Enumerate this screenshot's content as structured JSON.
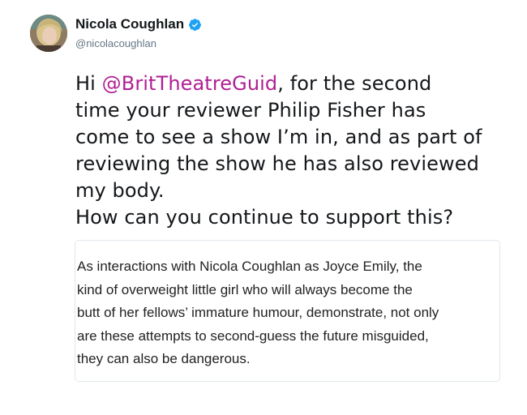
{
  "tweet": {
    "author": {
      "display_name": "Nicola Coughlan",
      "handle": "@nicolacoughlan",
      "verified": true,
      "verified_icon": "verified-badge-icon",
      "verified_color": "#1da1f2"
    },
    "text": {
      "line1_prefix": "Hi ",
      "mention": "@BritTheatreGuid",
      "line1_suffix": ", for the second",
      "line2": "time your reviewer Philip Fisher has",
      "line3": "come to see a show I’m in, and as part of",
      "line4": "reviewing the show he has also reviewed",
      "line5": "my body.",
      "line6": "How can you continue to support this?"
    },
    "mention_color": "#b01f94",
    "quoted_image_text": [
      "As interactions with Nicola Coughlan as Joyce Emily, the",
      "kind of overweight little girl who will always become the",
      "butt of her fellows’ immature humour, demonstrate, not only",
      "are these attempts to second-guess the future misguided,",
      "they can also be dangerous."
    ]
  }
}
